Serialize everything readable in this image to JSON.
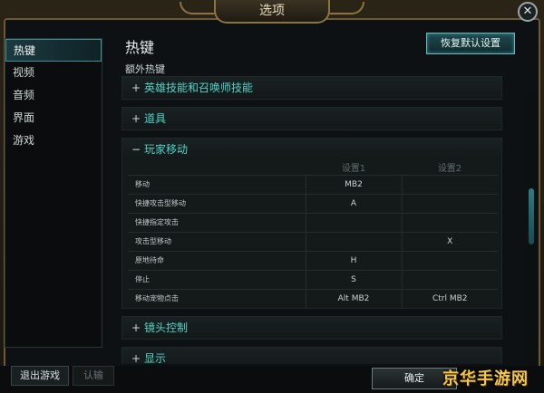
{
  "window": {
    "title": "选项"
  },
  "sidebar": {
    "items": [
      {
        "label": "热键",
        "active": true
      },
      {
        "label": "视频",
        "active": false
      },
      {
        "label": "音频",
        "active": false
      },
      {
        "label": "界面",
        "active": false
      },
      {
        "label": "游戏",
        "active": false
      }
    ]
  },
  "main": {
    "title": "热键",
    "reset_label": "恢复默认设置",
    "section_label": "额外热键",
    "groups": {
      "g0": {
        "sign": "+",
        "label": "英雄技能和召唤师技能"
      },
      "g1": {
        "sign": "+",
        "label": "道具"
      },
      "g2": {
        "sign": "−",
        "label": "玩家移动"
      },
      "g3": {
        "sign": "+",
        "label": "镜头控制"
      },
      "g4": {
        "sign": "+",
        "label": "显示"
      }
    },
    "table": {
      "headers": [
        "",
        "设置1",
        "设置2"
      ],
      "rows": [
        {
          "action": "移动",
          "key1": "MB2",
          "key2": ""
        },
        {
          "action": "快捷攻击型移动",
          "key1": "A",
          "key2": ""
        },
        {
          "action": "快捷指定攻击",
          "key1": "",
          "key2": ""
        },
        {
          "action": "攻击型移动",
          "key1": "",
          "key2": "X"
        },
        {
          "action": "原地待命",
          "key1": "H",
          "key2": ""
        },
        {
          "action": "停止",
          "key1": "S",
          "key2": ""
        },
        {
          "action": "移动宠物点击",
          "key1": "Alt MB2",
          "key2": "Ctrl MB2"
        }
      ]
    }
  },
  "footer": {
    "exit_label": "退出游戏",
    "surrender_label": "认输",
    "ok_label": "确定"
  },
  "watermark": "京华手游网",
  "colors": {
    "accent": "#4fd3c8",
    "frame_gold": "#8a7442",
    "panel": "#14191a"
  }
}
